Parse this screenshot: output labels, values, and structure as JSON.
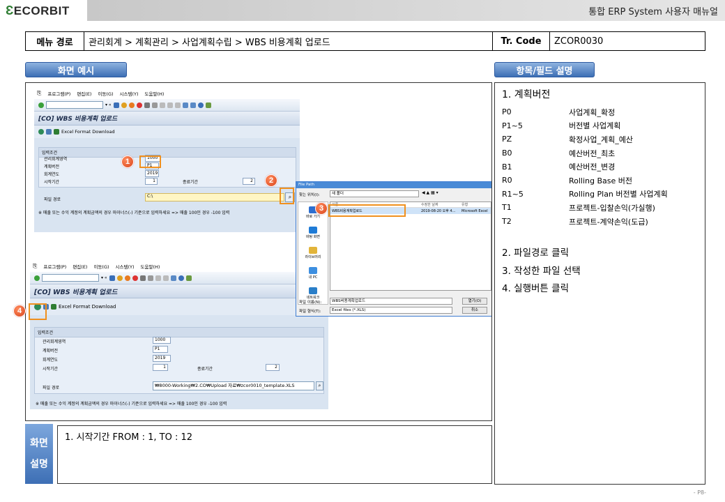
{
  "header": {
    "logo": "ECORBIT",
    "title": "통합 ERP System 사용자 매뉴얼"
  },
  "menu": {
    "label": "메뉴 경로",
    "path": "관리회계 > 계획관리 > 사업계획수립 > WBS 비용계획 업로드",
    "tr_label": "Tr. Code",
    "tr_value": "ZCOR0030"
  },
  "sections": {
    "screen_example": "화면 예시",
    "field_desc": "항목/필드 설명",
    "screen_desc_1": "화면",
    "screen_desc_2": "설명"
  },
  "sap1": {
    "menu": [
      "프로그램(P)",
      "편집(E)",
      "이동(G)",
      "시스템(Y)",
      "도움말(H)"
    ],
    "title": "[CO] WBS 비용계획 업로드",
    "app_button": "Excel Format Download",
    "group_title": "입력조건",
    "labels": {
      "area": "관리회계영역",
      "version": "계획버전",
      "year": "회계연도",
      "start": "시작기간",
      "end": "종료기간",
      "path": "파일 경로"
    },
    "values": {
      "area": "1000",
      "version": "P1",
      "year": "2019",
      "start": "1",
      "end": "2",
      "path": "C:\\"
    },
    "note": "※ 매출 또는 수익 계정의 계획금액의 경우 마이너스(-) 기준으로 입력하세요 => 매출 100인 경우 -100 입력"
  },
  "sap2": {
    "menu": [
      "프로그램(P)",
      "편집(E)",
      "이동(G)",
      "시스템(Y)",
      "도움말(H)"
    ],
    "title": "[CO] WBS 비용계획 업로드",
    "app_button": "Excel Format Download",
    "group_title": "입력조건",
    "labels": {
      "area": "관리회계영역",
      "version": "계획버전",
      "year": "회계연도",
      "start": "시작기간",
      "end": "종료기간",
      "path": "파일 경로"
    },
    "values": {
      "area": "1000",
      "version": "P1",
      "year": "2019",
      "start": "1",
      "end": "2",
      "path": "₩8000-Working₩2.CO₩Upload 자료₩zcor0010_template.XLS"
    },
    "note": "※ 매출 또는 수익 계정의 계획금액의 경우 마이너스(-) 기준으로 입력하세요 => 매출 100인 경우 -100 입력"
  },
  "dialog": {
    "title": "File Path",
    "lookin_label": "찾는 위치(I):",
    "lookin_value": "새 폴더",
    "places": [
      "바로 가기",
      "바탕 화면",
      "라이브러리",
      "내 PC",
      "네트워크"
    ],
    "columns": [
      "이름",
      "수정한 날짜",
      "유형"
    ],
    "file": {
      "name": "WBS비용계획업로드",
      "date": "2019-08-20 오후 4...",
      "type": "Microsoft Excel"
    },
    "filename_label": "파일 이름(N):",
    "filename_value": "WBS비용계획업로드",
    "filetype_label": "파일 형식(T):",
    "filetype_value": "Excel files (*.XLS)",
    "open": "열기(O)",
    "cancel": "취소"
  },
  "markers": [
    "1",
    "2",
    "3",
    "4"
  ],
  "fields": {
    "heading": "1.  계획버전",
    "rows": [
      {
        "code": "P0",
        "desc": "사업계획_확정"
      },
      {
        "code": "P1~5",
        "desc": "버전별 사업계획"
      },
      {
        "code": "PZ",
        "desc": "확정사업_계획_예산"
      },
      {
        "code": "B0",
        "desc": "예산버전_최초"
      },
      {
        "code": "B1",
        "desc": "예산버전_변경"
      },
      {
        "code": "R0",
        "desc": "Rolling Base 버전"
      },
      {
        "code": "R1~5",
        "desc": "Rolling Plan 버전별 사업계획"
      },
      {
        "code": "T1",
        "desc": "프로젝트-입찰손익(가실행)"
      },
      {
        "code": "T2",
        "desc": "프로젝트-계약손익(도급)"
      }
    ],
    "steps": [
      "2.   파일경로 클릭",
      "3.   작성한 파일 선택",
      "4.   실행버튼 클릭"
    ]
  },
  "screen_desc": "1.  시작기간 FROM : 1, TO : 12",
  "page_no": "- P8-"
}
